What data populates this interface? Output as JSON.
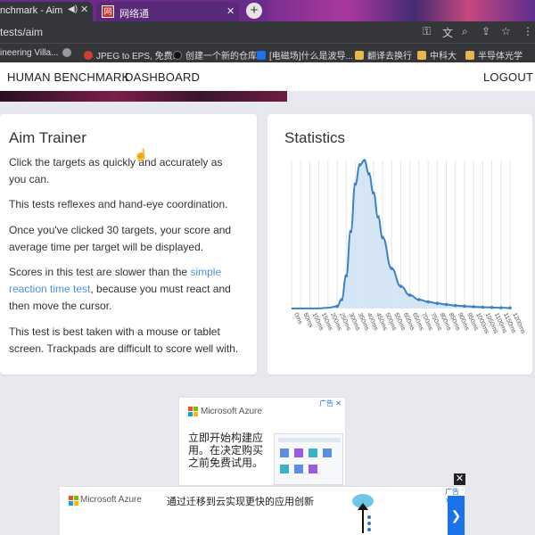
{
  "browser": {
    "active_tab": {
      "title": "nchmark - Aim",
      "mute_icon": "speaker-mute-icon",
      "close_icon": "close-icon"
    },
    "second_tab": {
      "title": "网络通",
      "close_icon": "close-icon"
    },
    "new_tab_label": "+",
    "address": "tests/aim",
    "address_icons": [
      "key-icon",
      "translate-icon",
      "zoom-icon",
      "share-icon",
      "star-icon",
      "more-icon"
    ]
  },
  "bookmarks": [
    {
      "label": "ineering Villa...",
      "color": "#e0a000"
    },
    {
      "label": "",
      "color": "#999999"
    },
    {
      "label": "JPEG to EPS, 免费...",
      "color": "#d04030"
    },
    {
      "label": "",
      "color": "#333333"
    },
    {
      "label": "创建一个新的仓库",
      "color": "#555555"
    },
    {
      "label": "[电磁场]什么是波导...",
      "color": "#1a73e8"
    },
    {
      "label": "翻译去换行",
      "color": "#e8b64a"
    },
    {
      "label": "中科大",
      "color": "#e8b64a"
    },
    {
      "label": "半导体光学",
      "color": "#e8b64a"
    }
  ],
  "nav": {
    "brand": "HUMAN BENCHMARK",
    "dashboard": "DASHBOARD",
    "logout": "LOGOUT"
  },
  "left_card": {
    "title": "Aim Trainer",
    "p1": "Click the targets as quickly and accurately as you can.",
    "p2": "This tests reflexes and hand-eye coordination.",
    "p3": "Once you've clicked 30 targets, your score and average time per target will be displayed.",
    "p4_before": "Scores in this test are slower than the ",
    "p4_link": "simple reaction time test",
    "p4_after": ", because you must react and then move the cursor.",
    "p5": "This test is best taken with a mouse or tablet screen. Trackpads are difficult to score well with."
  },
  "right_card": {
    "title": "Statistics"
  },
  "chart_data": {
    "type": "area",
    "title": "",
    "xlabel": "",
    "ylabel": "",
    "x": [
      "0ms",
      "50ms",
      "100ms",
      "150ms",
      "200ms",
      "250ms",
      "300ms",
      "350ms",
      "400ms",
      "450ms",
      "500ms",
      "550ms",
      "600ms",
      "650ms",
      "700ms",
      "750ms",
      "800ms",
      "850ms",
      "900ms",
      "950ms",
      "1000ms",
      "1050ms",
      "1100ms",
      "1150ms",
      "1200ms"
    ],
    "series": [
      {
        "name": "",
        "points": [
          [
            0,
            0
          ],
          [
            150,
            0.001
          ],
          [
            200,
            0.005
          ],
          [
            250,
            0.015
          ],
          [
            275,
            0.06
          ],
          [
            300,
            0.22
          ],
          [
            325,
            0.52
          ],
          [
            350,
            0.84
          ],
          [
            375,
            0.97
          ],
          [
            400,
            1.0
          ],
          [
            425,
            0.91
          ],
          [
            450,
            0.78
          ],
          [
            475,
            0.62
          ],
          [
            500,
            0.48
          ],
          [
            550,
            0.27
          ],
          [
            600,
            0.15
          ],
          [
            650,
            0.09
          ],
          [
            700,
            0.06
          ],
          [
            750,
            0.045
          ],
          [
            800,
            0.035
          ],
          [
            850,
            0.027
          ],
          [
            900,
            0.02
          ],
          [
            950,
            0.016
          ],
          [
            1000,
            0.012
          ],
          [
            1050,
            0.009
          ],
          [
            1100,
            0.007
          ],
          [
            1150,
            0.005
          ],
          [
            1200,
            0.004
          ]
        ]
      }
    ],
    "xlim": [
      0,
      1200
    ],
    "grid": true,
    "line_color": "#3b82c4",
    "fill_color": "#cfe2f3"
  },
  "ads": {
    "mid": {
      "brand": "Microsoft Azure",
      "badge": "广告 ✕",
      "headline": "立即开始构建应用。在决定购买之前免费试用。"
    },
    "bottom": {
      "brand": "Microsoft Azure",
      "badge": "广告 ✕",
      "headline": "通过迁移到云实现更快的应用创新",
      "next": "❯",
      "close": "✕"
    }
  }
}
